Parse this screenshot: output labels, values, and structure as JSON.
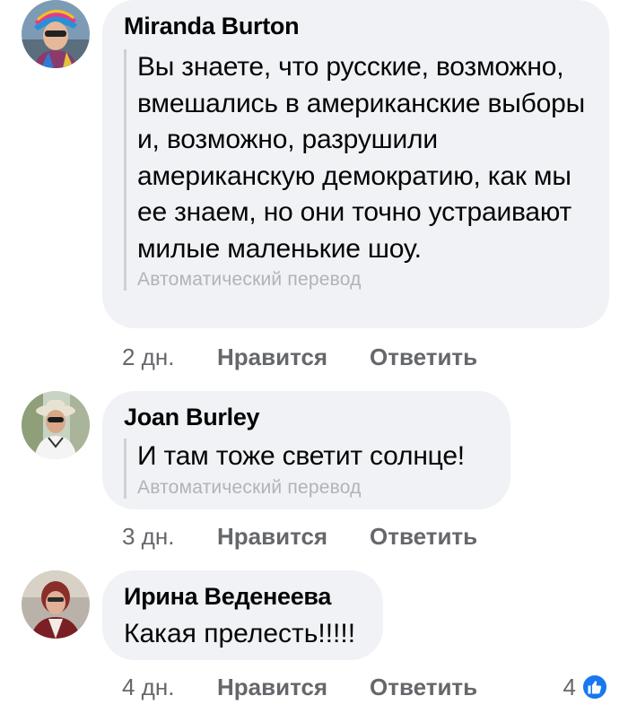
{
  "comments": [
    {
      "author": "Miranda Burton",
      "text": "Вы знаете, что русские, возможно, вмешались в американские выборы и, возможно, разрушили американскую демократию, как мы ее знаем, но они точно устраивают милые маленькие шоу.",
      "translation": "Автоматический перевод",
      "time": "2 дн.",
      "like": "Нравится",
      "reply": "Ответить"
    },
    {
      "author": "Joan Burley",
      "text": "И там тоже светит солнце!",
      "translation": "Автоматический перевод",
      "time": "3 дн.",
      "like": "Нравится",
      "reply": "Ответить"
    },
    {
      "author": "Ирина Веденеева",
      "text": "Какая прелесть!!!!!",
      "time": "4 дн.",
      "like": "Нравится",
      "reply": "Ответить",
      "reaction_count": "4",
      "reaction_icon": "thumbs-up-icon"
    }
  ],
  "colors": {
    "bubble": "#f0f2f5",
    "secondary_text": "#65676b",
    "translation_text": "#b0b3b8",
    "like_blue": "#1877f2"
  }
}
